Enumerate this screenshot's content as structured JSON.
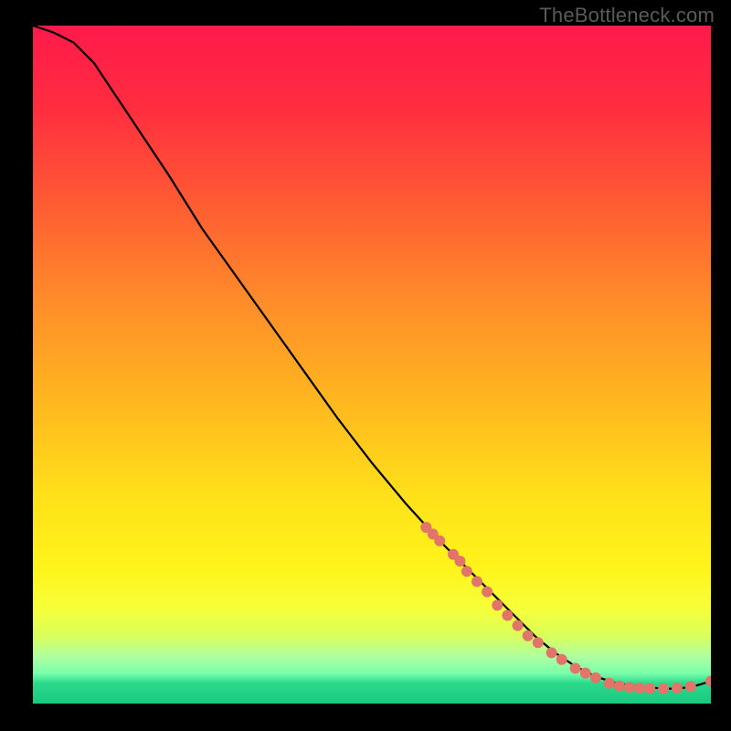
{
  "watermark": "TheBottleneck.com",
  "chart_data": {
    "type": "line",
    "title": "",
    "xlabel": "",
    "ylabel": "",
    "xlim": [
      0,
      100
    ],
    "ylim": [
      0,
      100
    ],
    "gradient_stops": [
      {
        "offset": 0.0,
        "color": "#ff1a4b"
      },
      {
        "offset": 0.12,
        "color": "#ff2d3f"
      },
      {
        "offset": 0.26,
        "color": "#ff5a33"
      },
      {
        "offset": 0.4,
        "color": "#ff8a2a"
      },
      {
        "offset": 0.55,
        "color": "#ffb61f"
      },
      {
        "offset": 0.7,
        "color": "#ffe21a"
      },
      {
        "offset": 0.8,
        "color": "#fff41a"
      },
      {
        "offset": 0.86,
        "color": "#f6ff3a"
      },
      {
        "offset": 0.9,
        "color": "#d9ff5a"
      },
      {
        "offset": 0.93,
        "color": "#b0ffa0"
      },
      {
        "offset": 0.955,
        "color": "#7affac"
      },
      {
        "offset": 0.97,
        "color": "#2bd98b"
      },
      {
        "offset": 1.0,
        "color": "#19c97f"
      }
    ],
    "series": [
      {
        "name": "curve",
        "color": "#000000",
        "x": [
          0,
          3,
          6,
          9,
          12,
          16,
          20,
          25,
          30,
          35,
          40,
          45,
          50,
          55,
          60,
          65,
          70,
          74,
          77,
          80,
          83,
          86,
          90,
          94,
          97,
          100
        ],
        "y": [
          100,
          99,
          97.5,
          94.5,
          90,
          84,
          78,
          70,
          63,
          56,
          49,
          42,
          35.5,
          29.5,
          24,
          19,
          14,
          10,
          7.5,
          5.5,
          4,
          3,
          2.4,
          2.2,
          2.4,
          3.3
        ]
      }
    ],
    "markers": {
      "color": "#e2746a",
      "radius_px": 6,
      "points": [
        {
          "x": 58,
          "y": 26
        },
        {
          "x": 59,
          "y": 25
        },
        {
          "x": 60,
          "y": 24
        },
        {
          "x": 62,
          "y": 22
        },
        {
          "x": 63,
          "y": 21
        },
        {
          "x": 64,
          "y": 19.5
        },
        {
          "x": 65.5,
          "y": 18
        },
        {
          "x": 67,
          "y": 16.5
        },
        {
          "x": 68.5,
          "y": 14.5
        },
        {
          "x": 70,
          "y": 13
        },
        {
          "x": 71.5,
          "y": 11.5
        },
        {
          "x": 73,
          "y": 10
        },
        {
          "x": 74.5,
          "y": 9
        },
        {
          "x": 76.5,
          "y": 7.5
        },
        {
          "x": 78,
          "y": 6.5
        },
        {
          "x": 80,
          "y": 5.2
        },
        {
          "x": 81.5,
          "y": 4.5
        },
        {
          "x": 83,
          "y": 3.8
        },
        {
          "x": 85,
          "y": 3.0
        },
        {
          "x": 86.5,
          "y": 2.6
        },
        {
          "x": 88,
          "y": 2.4
        },
        {
          "x": 89.5,
          "y": 2.3
        },
        {
          "x": 91,
          "y": 2.2
        },
        {
          "x": 93,
          "y": 2.2
        },
        {
          "x": 95,
          "y": 2.3
        },
        {
          "x": 97,
          "y": 2.5
        },
        {
          "x": 100,
          "y": 3.3
        }
      ]
    }
  }
}
